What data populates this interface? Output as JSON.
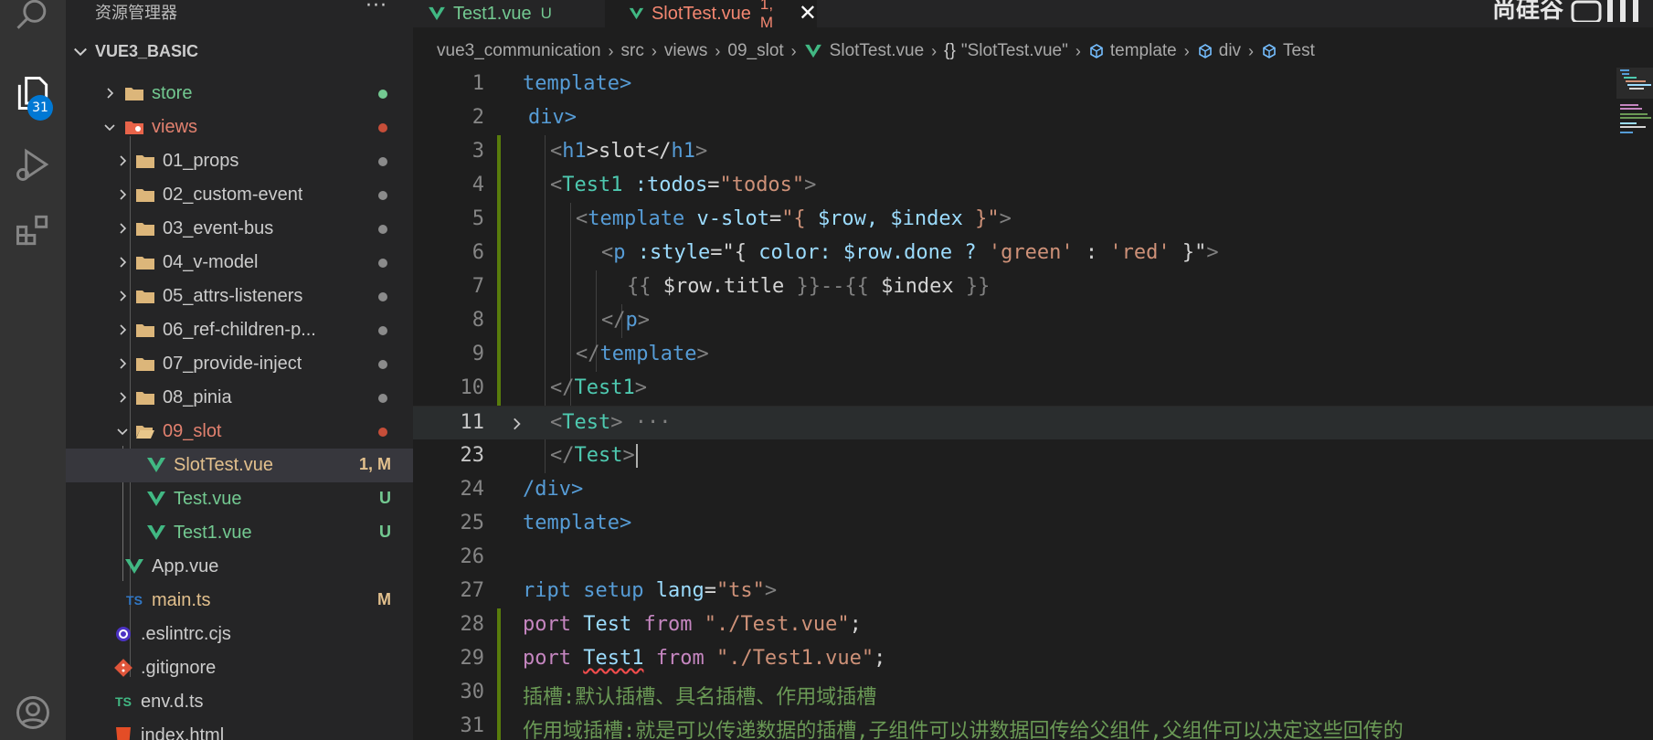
{
  "activity_bar": {
    "badge_count": "31"
  },
  "sidebar": {
    "title": "资源管理器",
    "more": "···",
    "root_label": "VUE3_BASIC"
  },
  "tree": [
    {
      "label": "store",
      "status": "",
      "dot": "#73c991"
    },
    {
      "label": "views",
      "status": "",
      "dot": "#c74e39"
    },
    {
      "label": "01_props",
      "status": "",
      "dot": "#8b8b8b"
    },
    {
      "label": "02_custom-event",
      "status": "",
      "dot": "#8b8b8b"
    },
    {
      "label": "03_event-bus",
      "status": "",
      "dot": "#8b8b8b"
    },
    {
      "label": "04_v-model",
      "status": "",
      "dot": "#8b8b8b"
    },
    {
      "label": "05_attrs-listeners",
      "status": "",
      "dot": "#8b8b8b"
    },
    {
      "label": "06_ref-children-p...",
      "status": "",
      "dot": "#8b8b8b"
    },
    {
      "label": "07_provide-inject",
      "status": "",
      "dot": "#8b8b8b"
    },
    {
      "label": "08_pinia",
      "status": "",
      "dot": "#8b8b8b"
    },
    {
      "label": "09_slot",
      "status": "",
      "dot": "#c74e39"
    },
    {
      "label": "SlotTest.vue",
      "status": "1, M"
    },
    {
      "label": "Test.vue",
      "status": "U"
    },
    {
      "label": "Test1.vue",
      "status": "U"
    },
    {
      "label": "App.vue",
      "status": ""
    },
    {
      "label": "main.ts",
      "status": "M"
    },
    {
      "label": ".eslintrc.cjs",
      "status": ""
    },
    {
      "label": ".gitignore",
      "status": ""
    },
    {
      "label": "env.d.ts",
      "status": ""
    },
    {
      "label": "index.html",
      "status": ""
    }
  ],
  "tabs": [
    {
      "label": "Test1.vue",
      "status": "U"
    },
    {
      "label": "SlotTest.vue",
      "status": "1, M",
      "close": "✕"
    }
  ],
  "watermark": "尚硅谷",
  "breadcrumbs": [
    "vue3_communication",
    "src",
    "views",
    "09_slot",
    "SlotTest.vue",
    "\"SlotTest.vue\"",
    "template",
    "div",
    "Test"
  ],
  "line_numbers": [
    "1",
    "2",
    "3",
    "4",
    "5",
    "6",
    "7",
    "8",
    "9",
    "10",
    "11",
    "23",
    "24",
    "25",
    "26",
    "27",
    "28",
    "29",
    "30",
    "31"
  ],
  "code": {
    "l1": "template>",
    "l2": "div>",
    "l3a": "<",
    "l3b": "h1",
    "l3c": ">slot</",
    "l3d": "h1",
    "l3e": ">",
    "l4a": "<",
    "l4b": "Test1",
    "l4c": " :todos",
    "l4d": "=",
    "l4e": "\"todos\"",
    "l4f": ">",
    "l5a": "<",
    "l5b": "template",
    "l5c": " v-slot",
    "l5d": "=",
    "l5e": "\"{ ",
    "l5f": "$row, $index",
    "l5g": " }\"",
    "l5h": ">",
    "l6a": "<",
    "l6b": "p",
    "l6c": " :style",
    "l6d": "=",
    "l6e": "\"{ ",
    "l6f": "color: $row.done ? ",
    "l6g": "'green'",
    "l6h": " : ",
    "l6i": "'red'",
    "l6j": " }\"",
    "l6k": ">",
    "l7a": "{{ ",
    "l7b": "$row.title",
    "l7c": " }}--{{ ",
    "l7d": "$index",
    "l7e": " }}",
    "l8a": "</",
    "l8b": "p",
    "l8c": ">",
    "l9a": "</",
    "l9b": "template",
    "l9c": ">",
    "l10a": "</",
    "l10b": "Test1",
    "l10c": ">",
    "l11a": "<",
    "l11b": "Test",
    "l11c": ">",
    "l11d": "···",
    "l23a": "</",
    "l23b": "Test",
    "l23c": ">",
    "l24": "/div>",
    "l25": "template>",
    "l27a": "ript setup ",
    "l27b": "lang",
    "l27c": "=",
    "l27d": "\"ts\"",
    "l27e": ">",
    "l28a": "port ",
    "l28b": "Test",
    "l28c": " from ",
    "l28d": "\"./Test.vue\"",
    "l28e": ";",
    "l29a": "port ",
    "l29b": "Test1",
    "l29c": " from ",
    "l29d": "\"./Test1.vue\"",
    "l29e": ";",
    "l30": "插槽:默认插槽、具名插槽、作用域插槽",
    "l31": "作用域插槽:就是可以传递数据的插槽,子组件可以讲数据回传给父组件,父组件可以决定这些回传的"
  },
  "colors": {
    "vue_green": "#41b883",
    "modified": "#e2c08d",
    "untracked": "#73c991",
    "error": "#f14c4c",
    "ts_blue": "#3178c6"
  }
}
